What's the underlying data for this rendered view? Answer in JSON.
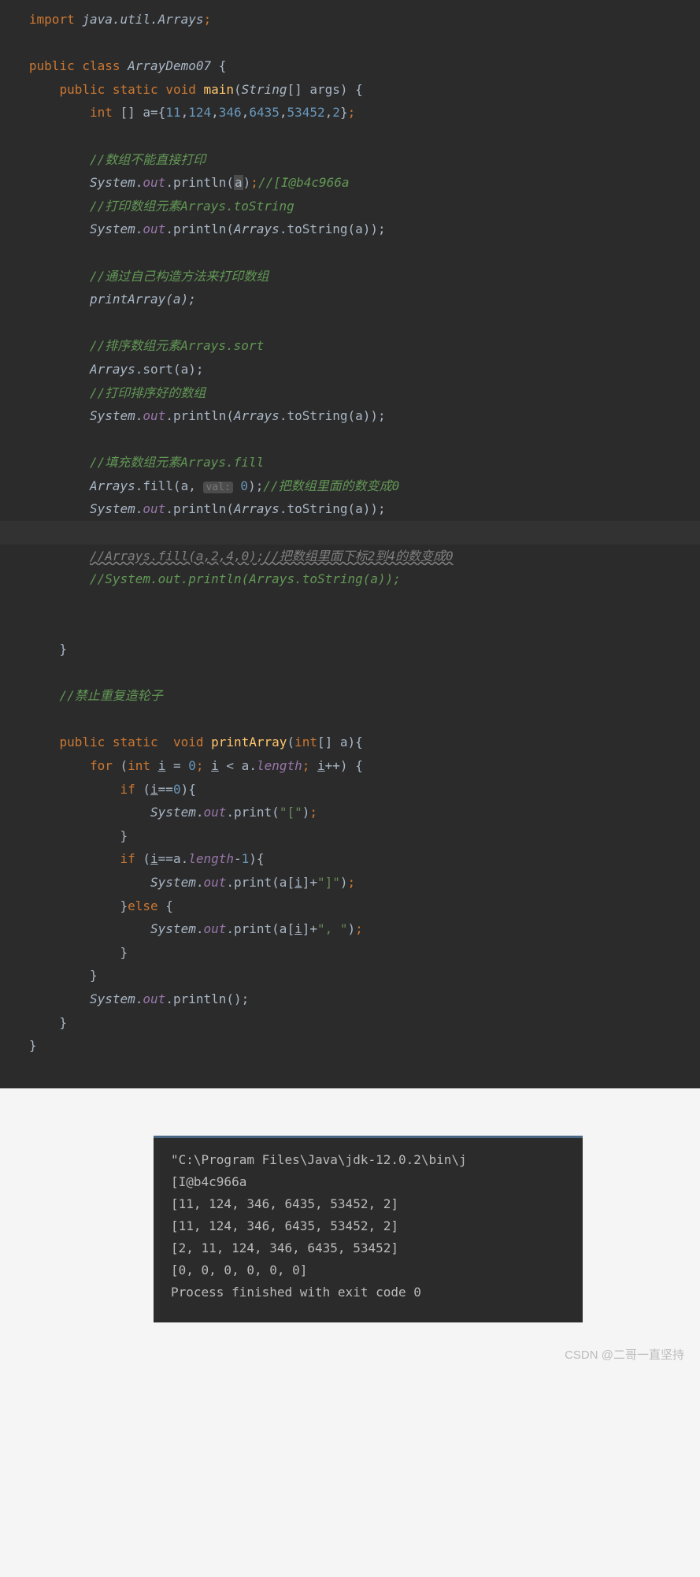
{
  "code": {
    "l1_import": "import",
    "l1_pkg": "java.util.Arrays",
    "l3_public": "public",
    "l3_class": "class",
    "l3_name": "ArrayDemo07",
    "l4_public": "public",
    "l4_static": "static",
    "l4_void": "void",
    "l4_main": "main",
    "l4_type": "String",
    "l4_args": "[] args) {",
    "l5_int": "int",
    "l5_decl": " [] a={",
    "l5_n1": "11",
    "l5_n2": "124",
    "l5_n3": "346",
    "l5_n4": "6435",
    "l5_n5": "53452",
    "l5_n6": "2",
    "l7_c": "//数组不能直接打印",
    "l8_sys": "System",
    "l8_out": "out",
    "l8_println": ".println(",
    "l8_a": "a",
    "l8_c": "//[I@b4c966a",
    "l9_c": "//打印数组元素Arrays.toString",
    "l10_sys": "System",
    "l10_out": "out",
    "l10_println": ".println(",
    "l10_arr": "Arrays",
    "l10_tostr": ".toString(a));",
    "l12_c": "//通过自己构造方法来打印数组",
    "l13_call": "printArray(a);",
    "l15_c": "//排序数组元素Arrays.sort",
    "l16_arr": "Arrays",
    "l16_sort": ".sort(a);",
    "l17_c": "//打印排序好的数组",
    "l18_sys": "System",
    "l18_out": "out",
    "l18_println": ".println(",
    "l18_arr": "Arrays",
    "l18_tostr": ".toString(a));",
    "l20_c": "//填充数组元素Arrays.fill",
    "l21_arr": "Arrays",
    "l21_fill": ".fill(a, ",
    "l21_hint": "val:",
    "l21_val": "0",
    "l21_end": ");",
    "l21_c": "//把数组里面的数变成0",
    "l22_sys": "System",
    "l22_out": "out",
    "l22_println": ".println(",
    "l22_arr": "Arrays",
    "l22_tostr": ".toString(a));",
    "l24_c": "//Arrays.fill(a,2,4,0);//把数组里面下标2到4的数变成0",
    "l25_c": "//System.out.println(Arrays.toString(a));",
    "l30_c": "//禁止重复造轮子",
    "l32_public": "public",
    "l32_static": "static",
    "l32_void": "void",
    "l32_name": "printArray",
    "l32_int": "int",
    "l32_param": "[] a){",
    "l33_for": "for",
    "l33_int": "int",
    "l33_i": "i",
    "l33_eq": " = ",
    "l33_zero": "0",
    "l33_semi": "; ",
    "l33_cond": " < a.",
    "l33_len": "length",
    "l33_inc": "++) {",
    "l34_if": "if",
    "l34_cond": "==",
    "l34_zero": "0",
    "l35_sys": "System",
    "l35_out": "out",
    "l35_print": ".print(",
    "l35_str": "\"[\"",
    "l37_if": "if",
    "l37_cond": "==a.",
    "l37_len": "length",
    "l37_minus": "-",
    "l37_one": "1",
    "l38_sys": "System",
    "l38_out": "out",
    "l38_print": ".print(a[",
    "l38_plus": "]+",
    "l38_str": "\"]\"",
    "l39_else": "else",
    "l40_sys": "System",
    "l40_out": "out",
    "l40_print": ".print(a[",
    "l40_plus": "]+",
    "l40_str": "\", \"",
    "l43_sys": "System",
    "l43_out": "out",
    "l43_println": ".println();"
  },
  "console": {
    "l1": "\"C:\\Program Files\\Java\\jdk-12.0.2\\bin\\j",
    "l2": "[I@b4c966a",
    "l3": "[11, 124, 346, 6435, 53452, 2]",
    "l4": "[11, 124, 346, 6435, 53452, 2]",
    "l5": "[2, 11, 124, 346, 6435, 53452]",
    "l6": "[0, 0, 0, 0, 0, 0]",
    "l7": "",
    "l8": "Process finished with exit code 0"
  },
  "watermark": "CSDN @二哥一直坚持"
}
